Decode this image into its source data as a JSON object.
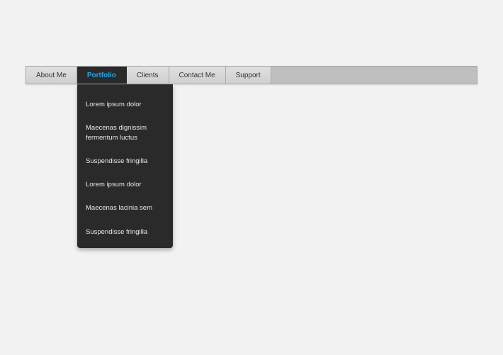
{
  "nav": {
    "items": [
      {
        "label": "About Me"
      },
      {
        "label": "Portfolio"
      },
      {
        "label": "Clients"
      },
      {
        "label": "Contact Me"
      },
      {
        "label": "Support"
      }
    ]
  },
  "dropdown": {
    "items": [
      {
        "label": "Lorem ipsum dolor"
      },
      {
        "label": "Maecenas dignissim fermentum luctus"
      },
      {
        "label": "Suspendisse fringilla"
      },
      {
        "label": "Lorem ipsum dolor"
      },
      {
        "label": "Maecenas lacinia sem"
      },
      {
        "label": "Suspendisse fringilla"
      }
    ]
  }
}
